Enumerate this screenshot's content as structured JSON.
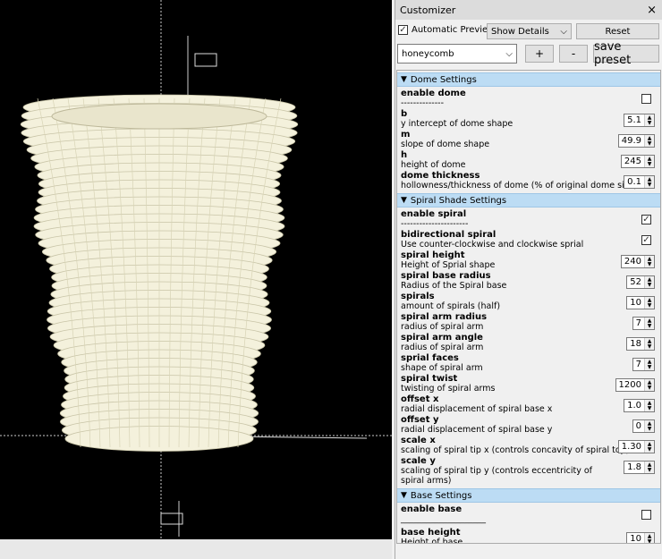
{
  "panel": {
    "title": "Customizer",
    "close": "×",
    "auto_preview": "Automatic Preview",
    "auto_preview_checked": true,
    "details": "Show Details",
    "reset": "Reset",
    "preset": "honeycomb",
    "plus": "+",
    "minus": "-",
    "save_preset": "save preset"
  },
  "groups": [
    {
      "title": "Dome Settings",
      "params": [
        {
          "name": "enable dome",
          "desc": "--------------",
          "type": "check",
          "value": false
        },
        {
          "name": "b",
          "desc": "y intercept of dome shape",
          "type": "spin",
          "value": "5.1"
        },
        {
          "name": "m",
          "desc": "slope of dome shape",
          "type": "spin",
          "value": "49.9"
        },
        {
          "name": "h",
          "desc": "height of dome",
          "type": "spin",
          "value": "245"
        },
        {
          "name": "dome thickness",
          "desc": "hollowness/thickness of dome (% of original dome size)",
          "type": "spin",
          "value": "0.1"
        }
      ]
    },
    {
      "title": "Spiral Shade Settings",
      "params": [
        {
          "name": "enable spiral",
          "desc": "----------------------",
          "type": "check",
          "value": true
        },
        {
          "name": "bidirectional spiral",
          "desc": "Use counter-clockwise and clockwise sprial",
          "type": "check",
          "value": true
        },
        {
          "name": "spiral height",
          "desc": "Height of Sprial shape",
          "type": "spin",
          "value": "240"
        },
        {
          "name": "spiral base radius",
          "desc": "Radius of the Spiral base",
          "type": "spin",
          "value": "52"
        },
        {
          "name": "spirals",
          "desc": "amount of spirals (half)",
          "type": "spin",
          "value": "10"
        },
        {
          "name": "spiral arm radius",
          "desc": "radius of spiral arm",
          "type": "spin",
          "value": "7"
        },
        {
          "name": "spiral arm angle",
          "desc": "radius of spiral arm",
          "type": "spin",
          "value": "18"
        },
        {
          "name": "sprial faces",
          "desc": "shape of spiral arm",
          "type": "spin",
          "value": "7"
        },
        {
          "name": "spiral twist",
          "desc": "twisting of spiral arms",
          "type": "spin",
          "value": "1200"
        },
        {
          "name": "offset x",
          "desc": "radial displacement of spiral base x",
          "type": "spin",
          "value": "1.0"
        },
        {
          "name": "offset y",
          "desc": "radial displacement of spiral base y",
          "type": "spin",
          "value": "0"
        },
        {
          "name": "scale x",
          "desc": "scaling of spiral tip x (controls concavity of spiral top)",
          "type": "spin",
          "value": "1.30"
        },
        {
          "name": "scale y",
          "desc": "scaling of spiral tip y (controls eccentricity of spiral arms)",
          "type": "spin",
          "value": "1.8"
        }
      ]
    },
    {
      "title": "Base Settings",
      "params": [
        {
          "name": "enable base",
          "desc": "____________________",
          "type": "check",
          "value": false
        },
        {
          "name": "base height",
          "desc": "Height of base",
          "type": "spin",
          "value": "10"
        }
      ]
    }
  ]
}
